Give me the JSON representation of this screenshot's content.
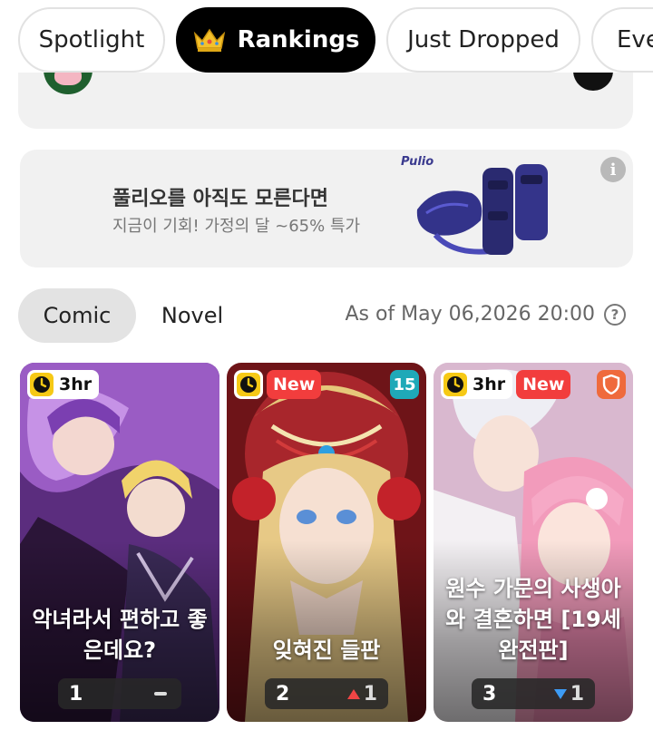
{
  "tabs": [
    {
      "label": "Spotlight",
      "active": false
    },
    {
      "label": "Rankings",
      "active": true,
      "icon": "crown-icon"
    },
    {
      "label": "Just Dropped",
      "active": false
    },
    {
      "label": "Eve",
      "active": false
    }
  ],
  "ad": {
    "title": "풀리오를 아직도 모른다면",
    "subtitle": "지금이 기회! 가정의 달 ~65% 특가",
    "brand": "Pulio",
    "info_icon": "info-icon"
  },
  "filters": {
    "chips": [
      {
        "label": "Comic",
        "active": true
      },
      {
        "label": "Novel",
        "active": false
      }
    ],
    "as_of": "As of May 06,2026 20:00",
    "help_icon": "question-circle-icon"
  },
  "cards": [
    {
      "time_badge": "3hr",
      "new_badge": null,
      "title": "악녀라서 편하고 좋은데요?",
      "rank": "1",
      "change": "",
      "trend": "same",
      "palette": [
        "#7a3fa6",
        "#c48be0",
        "#3b2150"
      ]
    },
    {
      "time_badge": null,
      "new_badge": "New",
      "corner_badge": "15",
      "title": "잊혀진 들판",
      "rank": "2",
      "change": "1",
      "trend": "up",
      "palette": [
        "#8e1f24",
        "#e2c37a",
        "#4a0e10"
      ]
    },
    {
      "time_badge": "3hr",
      "new_badge": "New",
      "corner_icon": "shield-icon",
      "title": "원수 가문의 사생아와 결혼하면 [19세 완전판]",
      "rank": "3",
      "change": "1",
      "trend": "down",
      "palette": [
        "#f2b6c9",
        "#d97fa3",
        "#b9a9c9"
      ]
    }
  ]
}
